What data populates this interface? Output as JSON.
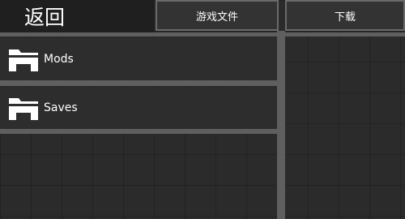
{
  "header": {
    "back_label": "返回",
    "tabs": [
      {
        "label": "游戏文件"
      },
      {
        "label": "下载"
      }
    ]
  },
  "folders": [
    {
      "label": "Mods",
      "icon": "folder-icon"
    },
    {
      "label": "Saves",
      "icon": "folder-icon"
    }
  ],
  "colors": {
    "background": "#2b2b2b",
    "back_button": "#1f1f1f",
    "tab_border": "#6a6a6a",
    "divider": "#5f5f5f",
    "text": "#ffffff"
  }
}
